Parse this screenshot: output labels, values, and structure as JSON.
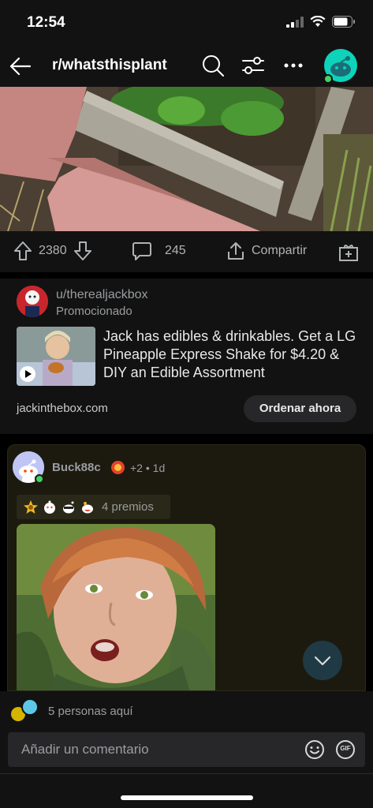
{
  "status_bar": {
    "time": "12:54",
    "icons": [
      "signal-icon",
      "wifi-icon",
      "battery-icon"
    ]
  },
  "header": {
    "subreddit": "r/whatsthisplant",
    "icons": [
      "back-arrow-icon",
      "search-icon",
      "filter-icon",
      "more-icon",
      "avatar"
    ]
  },
  "post_actions": {
    "upvotes": "2380",
    "comments": "245",
    "share_label": "Compartir"
  },
  "promoted": {
    "username": "u/therealjackbox",
    "promoted_label": "Promocionado",
    "headline": "Jack has edibles & drinkables. Get a LG Pineapple Express Shake for $4.20 & DIY an Edible Assortment",
    "domain": "jackinthebox.com",
    "cta": "Ordenar ahora"
  },
  "comment": {
    "author": "Buck88c",
    "score_extra": "+2",
    "separator": "•",
    "age": "1d",
    "awards_text": "4 premios"
  },
  "presence": {
    "text": "5 personas aquí"
  },
  "composer": {
    "placeholder": "Añadir un comentario",
    "gif_label": "GIF"
  },
  "colors": {
    "background": "#121212",
    "online": "#46d160",
    "comment_card": "#1c1a0f"
  }
}
